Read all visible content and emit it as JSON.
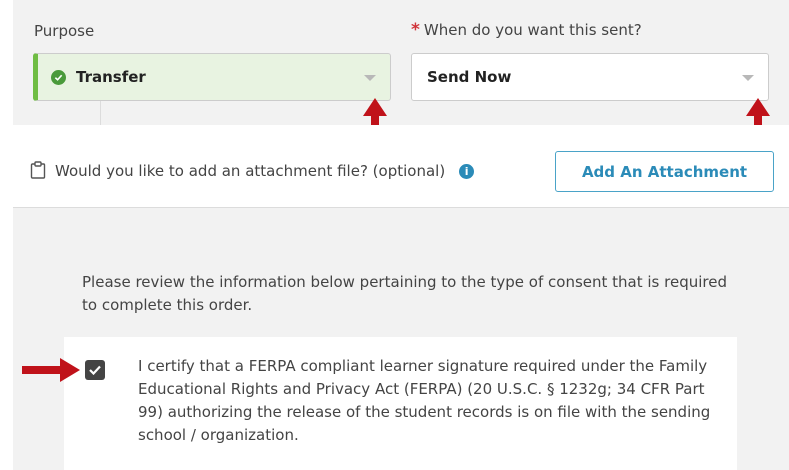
{
  "purpose": {
    "label": "Purpose",
    "value": "Transfer"
  },
  "send_time": {
    "required_marker": "*",
    "label": "When do you want this sent?",
    "value": "Send Now"
  },
  "attachment": {
    "prompt": "Would you like to add an attachment file? (optional)",
    "button_label": "Add An Attachment"
  },
  "consent": {
    "intro": "Please review the information below pertaining to the type of consent that is required to complete this order.",
    "checkbox_checked": true,
    "certification_text": "I certify that a FERPA compliant learner signature required under the Family Educational Rights and Privacy Act (FERPA) (20 U.S.C. § 1232g; 34 CFR Part 99) authorizing the release of the student records is on file with the sending school / organization."
  },
  "colors": {
    "accent_blue": "#2b8bb8",
    "success_green": "#6fbd43",
    "required_red": "#d0343a",
    "arrow_red": "#c0121a"
  },
  "icons": [
    "check-circle-icon",
    "chevron-down-icon",
    "clipboard-icon",
    "info-icon",
    "checkmark-icon",
    "red-arrow-annotation"
  ]
}
